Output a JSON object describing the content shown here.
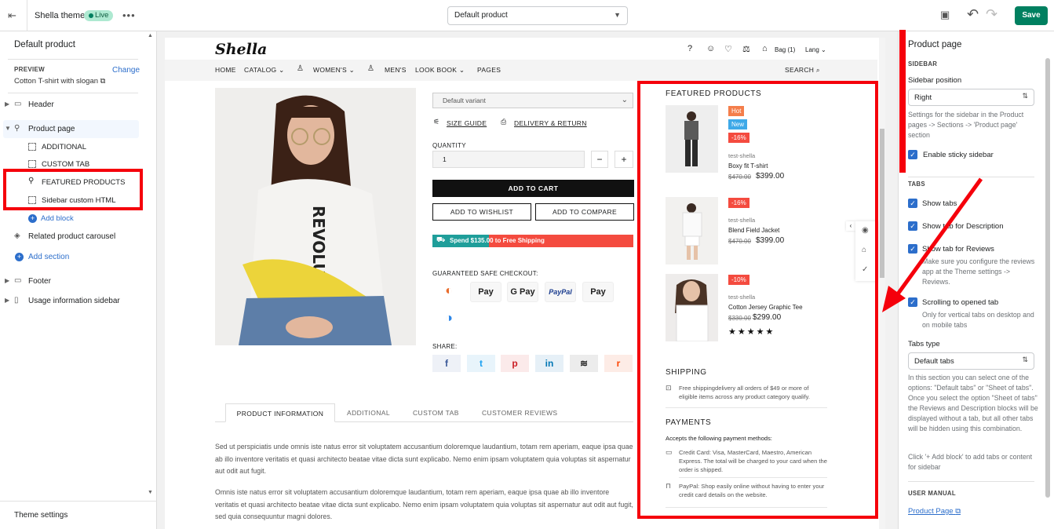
{
  "topbar": {
    "theme_name": "Shella theme",
    "live": "Live",
    "template": "Default product",
    "save": "Save"
  },
  "left": {
    "title": "Default product",
    "preview_label": "PREVIEW",
    "change": "Change",
    "preview_value": "Cotton T-shirt with slogan",
    "items": [
      {
        "label": "Header"
      },
      {
        "label": "Product page"
      },
      {
        "label": "ADDITIONAL"
      },
      {
        "label": "CUSTOM TAB"
      },
      {
        "label": "FEATURED PRODUCTS"
      },
      {
        "label": "Sidebar custom HTML"
      },
      {
        "label": "Add block"
      },
      {
        "label": "Related product carousel"
      },
      {
        "label": "Add section"
      },
      {
        "label": "Footer"
      },
      {
        "label": "Usage information sidebar"
      }
    ],
    "theme_settings": "Theme settings"
  },
  "store": {
    "logo": "Shella",
    "bag": "Bag (1)",
    "lang": "Lang",
    "nav": [
      "HOME",
      "CATALOG",
      "WOMEN'S",
      "MEN'S",
      "LOOK BOOK",
      "PAGES"
    ],
    "search": "SEARCH",
    "variant": "Default variant",
    "size_guide": "SIZE GUIDE",
    "delivery": "DELIVERY & RETURN",
    "quantity_label": "QUANTITY",
    "quantity": "1",
    "minus": "−",
    "plus": "+",
    "add_to_cart": "ADD TO CART",
    "add_to_wishlist": "ADD TO WISHLIST",
    "add_to_compare": "ADD TO COMPARE",
    "shipping_progress_text": "Spend $135.00 to Free Shipping",
    "shipping_progress": 0.28,
    "secure_checkout": "GUARANTEED SAFE CHECKOUT:",
    "payments": [
      "Pay",
      "G Pay",
      "PayPal",
      "Pay"
    ],
    "share": "SHARE:",
    "share_icons": [
      "f",
      "t",
      "p",
      "in",
      "≋",
      "r"
    ],
    "shirt_text": "REVOLUTI",
    "tabs": [
      "PRODUCT INFORMATION",
      "ADDITIONAL",
      "CUSTOM TAB",
      "CUSTOMER REVIEWS"
    ],
    "desc1": "Sed ut perspiciatis unde omnis iste natus error sit voluptatem accusantium doloremque laudantium, totam rem aperiam, eaque ipsa quae ab illo inventore veritatis et quasi architecto beatae vitae dicta sunt explicabo. Nemo enim ipsam voluptatem quia voluptas sit aspernatur aut odit aut fugit.",
    "desc2": "Omnis iste natus error sit voluptatem accusantium doloremque laudantium, totam rem aperiam, eaque ipsa quae ab illo inventore veritatis et quasi architecto beatae vitae dicta sunt explicabo. Nemo enim ipsam voluptatem quia voluptas sit aspernatur aut odit aut fugit, sed quia consequuntur magni dolores."
  },
  "featured": {
    "title": "FEATURED PRODUCTS",
    "products": [
      {
        "badges": [
          "Hot",
          "New",
          "-16%"
        ],
        "vendor": "test-shella",
        "name": "Boxy fit T-shirt",
        "old_price": "$470.00",
        "price": "$399.00"
      },
      {
        "badges": [
          "-16%"
        ],
        "vendor": "test-shella",
        "name": "Blend Field Jacket",
        "old_price": "$470.00",
        "price": "$399.00"
      },
      {
        "badges": [
          "-10%"
        ],
        "vendor": "test-shella",
        "name": "Cotton Jersey Graphic Tee",
        "old_price": "$330.00",
        "price": "$299.00",
        "stars": "★★★★★"
      }
    ],
    "shipping_title": "SHIPPING",
    "shipping_text": "Free shippingdelivery all orders of $49 or more of eligible items across any product category qualify.",
    "payments_title": "PAYMENTS",
    "payments_intro": "Accepts the following payment methods:",
    "payment_credit": "Credit Card: Visa, MasterCard, Maestro, American Express. The total will be charged to your card when the order is shipped.",
    "payment_paypal": "PayPal: Shop easily online without having to enter your credit card details on the website."
  },
  "right": {
    "title": "Product page",
    "sidebar_caption": "SIDEBAR",
    "sidebar_position_label": "Sidebar position",
    "sidebar_position": "Right",
    "sidebar_help": "Settings for the sidebar in the Product pages -> Sections -> 'Product page' section",
    "sticky": "Enable sticky sidebar",
    "tabs_caption": "TABS",
    "show_tabs": "Show tabs",
    "show_tab_desc": "Show tab for Description",
    "show_tab_reviews": "Show tab for Reviews",
    "reviews_help": "Make sure you configure the reviews app at the Theme settings -> Reviews.",
    "scroll_tab": "Scrolling to opened tab",
    "scroll_help": "Only for vertical tabs on desktop and on mobile tabs",
    "tabs_type_label": "Tabs type",
    "tabs_type": "Default tabs",
    "tabs_help": "In this section you can select one of the options: \"Default tabs\" or \"Sheet of tabs\". Once you select the option \"Sheet of tabs\" the Reviews and Description blocks will be displayed without a tab, but all other tabs will be hidden using this combination.",
    "add_block_help": "Click '+ Add block' to add tabs or content for sidebar",
    "manual_caption": "USER MANUAL",
    "manual_link": "Product Page"
  },
  "colors": {
    "accent": "#008060",
    "link": "#2c6ecb",
    "highlight": "#f5000b",
    "hot": "#f47e4b",
    "new": "#3ea9e8",
    "sale": "#f44b3f"
  }
}
